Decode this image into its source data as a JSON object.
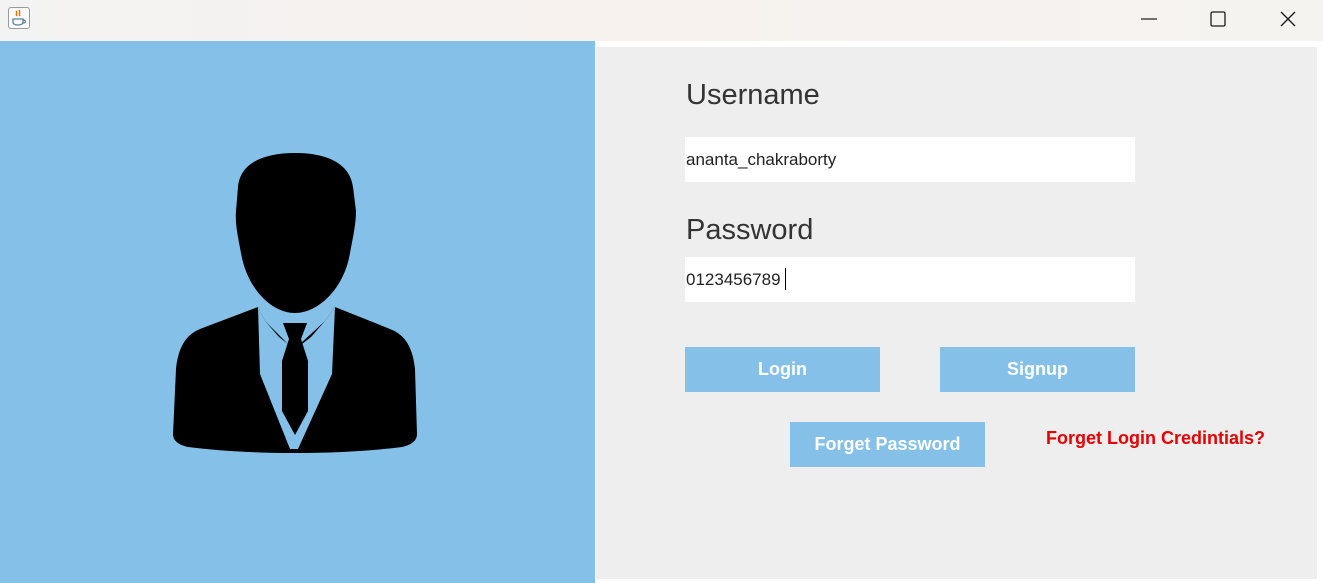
{
  "window": {
    "icons": [
      "java-app-icon",
      "minimize-icon",
      "maximize-icon",
      "close-icon"
    ]
  },
  "form": {
    "username_label": "Username",
    "username_value": "ananta_chakraborty",
    "password_label": "Password",
    "password_value": "0123456789",
    "login_button": "Login",
    "signup_button": "Signup",
    "forget_password_button": "Forget Password",
    "forget_credentials_link": "Forget Login Credintials?"
  },
  "colors": {
    "accent": "#84c0e7",
    "panel": "#eeeeee",
    "link": "#e60000"
  }
}
